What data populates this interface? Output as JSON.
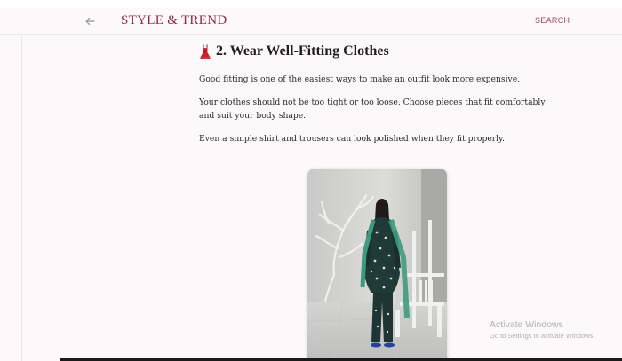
{
  "browser": {
    "top_fragment": "..."
  },
  "header": {
    "back_icon": "arrow-left-icon",
    "brand": "STYLE & TREND",
    "search_label": "SEARCH"
  },
  "article": {
    "heading_icon": "dress-icon",
    "heading": "2. Wear Well-Fitting Clothes",
    "paragraphs": [
      "Good fitting is one of the easiest ways to make an outfit look more expensive.",
      "Your clothes should not be too tight or too loose. Choose pieces that fit comfortably and suit your body shape.",
      "Even a simple shirt and trousers can look polished when they fit properly."
    ]
  },
  "watermark": {
    "title": "Activate Windows",
    "subtitle": "Go to Settings to activate Windows."
  },
  "colors": {
    "brand": "#8a2a48",
    "accent": "#a0456a",
    "page_background": "#fdf8f9",
    "outfit_teal": "#3f9a7d"
  }
}
